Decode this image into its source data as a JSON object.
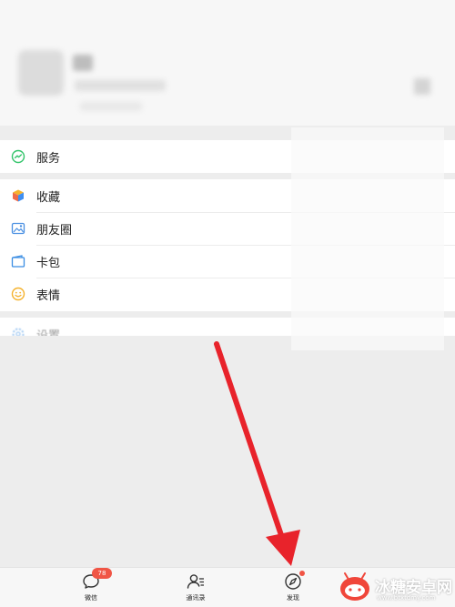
{
  "menu": {
    "service": {
      "label": "服务",
      "icon": "service-icon",
      "color": "#33c46b"
    },
    "items": [
      {
        "label": "收藏",
        "icon": "favorites-cube-icon"
      },
      {
        "label": "朋友圈",
        "icon": "moments-photo-icon"
      },
      {
        "label": "卡包",
        "icon": "card-wallet-icon"
      },
      {
        "label": "表情",
        "icon": "emoji-smile-icon"
      }
    ],
    "settings": {
      "label": "设置",
      "icon": "settings-gear-icon"
    }
  },
  "tabbar": {
    "tabs": [
      {
        "label": "微信",
        "icon": "chat-bubble-icon",
        "badge": "78"
      },
      {
        "label": "通讯录",
        "icon": "contacts-icon"
      },
      {
        "label": "发现",
        "icon": "compass-icon",
        "dot": true
      }
    ]
  },
  "annotation": {
    "arrow_color": "#e8232b"
  },
  "watermark": {
    "name": "冰糖安卓网",
    "url": "www.btxtdmy.com"
  }
}
